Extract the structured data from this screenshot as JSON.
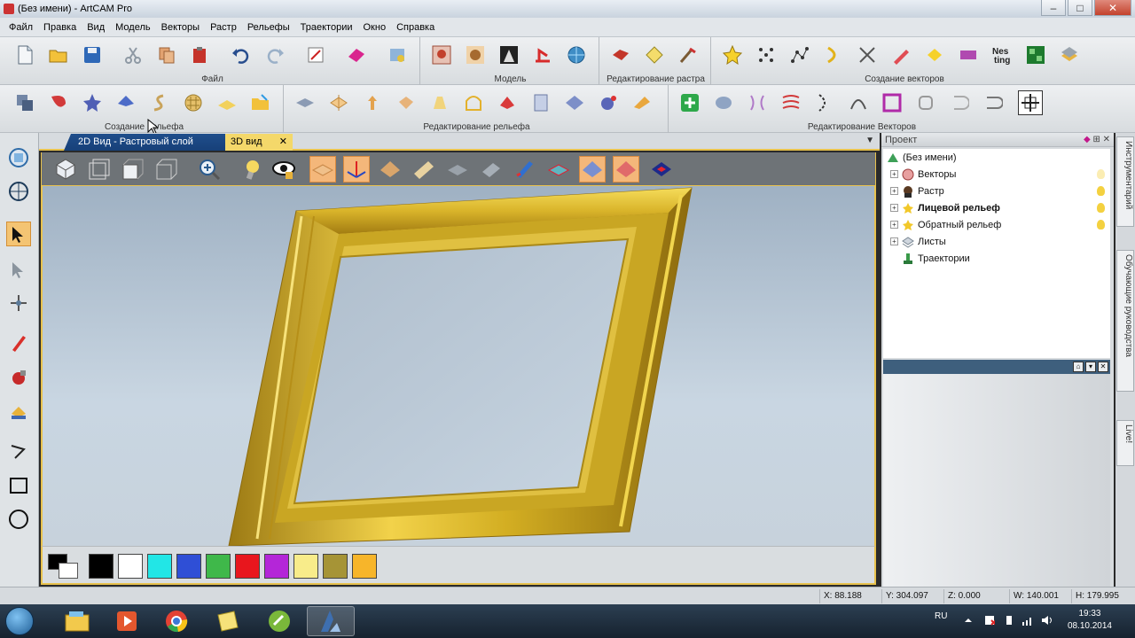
{
  "window": {
    "title": "(Без имени) - ArtCAM Pro",
    "minimize": "–",
    "maximize": "□",
    "close": "✕"
  },
  "menu": [
    "Файл",
    "Правка",
    "Вид",
    "Модель",
    "Векторы",
    "Растр",
    "Рельефы",
    "Траектории",
    "Окно",
    "Справка"
  ],
  "toolbar_groups": {
    "file": "Файл",
    "model": "Модель",
    "raster_edit": "Редактирование растра",
    "vector_create": "Создание векторов",
    "relief_create": "Создание рельефа",
    "relief_edit": "Редактирование рельефа",
    "vector_edit": "Редактирование Векторов"
  },
  "tabs": {
    "tab_2d": "2D Вид - Растровый слой",
    "tab_3d": "3D вид",
    "tab_close": "✕",
    "dropdown": "▼"
  },
  "palette": {
    "colors": [
      "#000000",
      "#ffffff",
      "#22e6e6",
      "#2f4fd6",
      "#3fb84a",
      "#e8161d",
      "#b426d8",
      "#f8ec8a",
      "#a69436",
      "#f7b52a"
    ]
  },
  "project": {
    "header": "Проект",
    "root": "(Без имени)",
    "items": [
      {
        "label": "Векторы",
        "bold": false
      },
      {
        "label": "Растр",
        "bold": false
      },
      {
        "label": "Лицевой рельеф",
        "bold": true
      },
      {
        "label": "Обратный рельеф",
        "bold": false
      },
      {
        "label": "Листы",
        "bold": false
      },
      {
        "label": "Траектории",
        "bold": false
      }
    ],
    "expand": "+"
  },
  "side_tabs": {
    "tools": "Инструментарий",
    "tutorials": "Обучающие руководства",
    "live": "Live!"
  },
  "status": {
    "x": "X: 88.188",
    "y": "Y: 304.097",
    "z": "Z: 0.000",
    "w": "W: 140.001",
    "h": "H: 179.995"
  },
  "taskbar": {
    "lang": "RU",
    "time": "19:33",
    "date": "08.10.2014"
  }
}
